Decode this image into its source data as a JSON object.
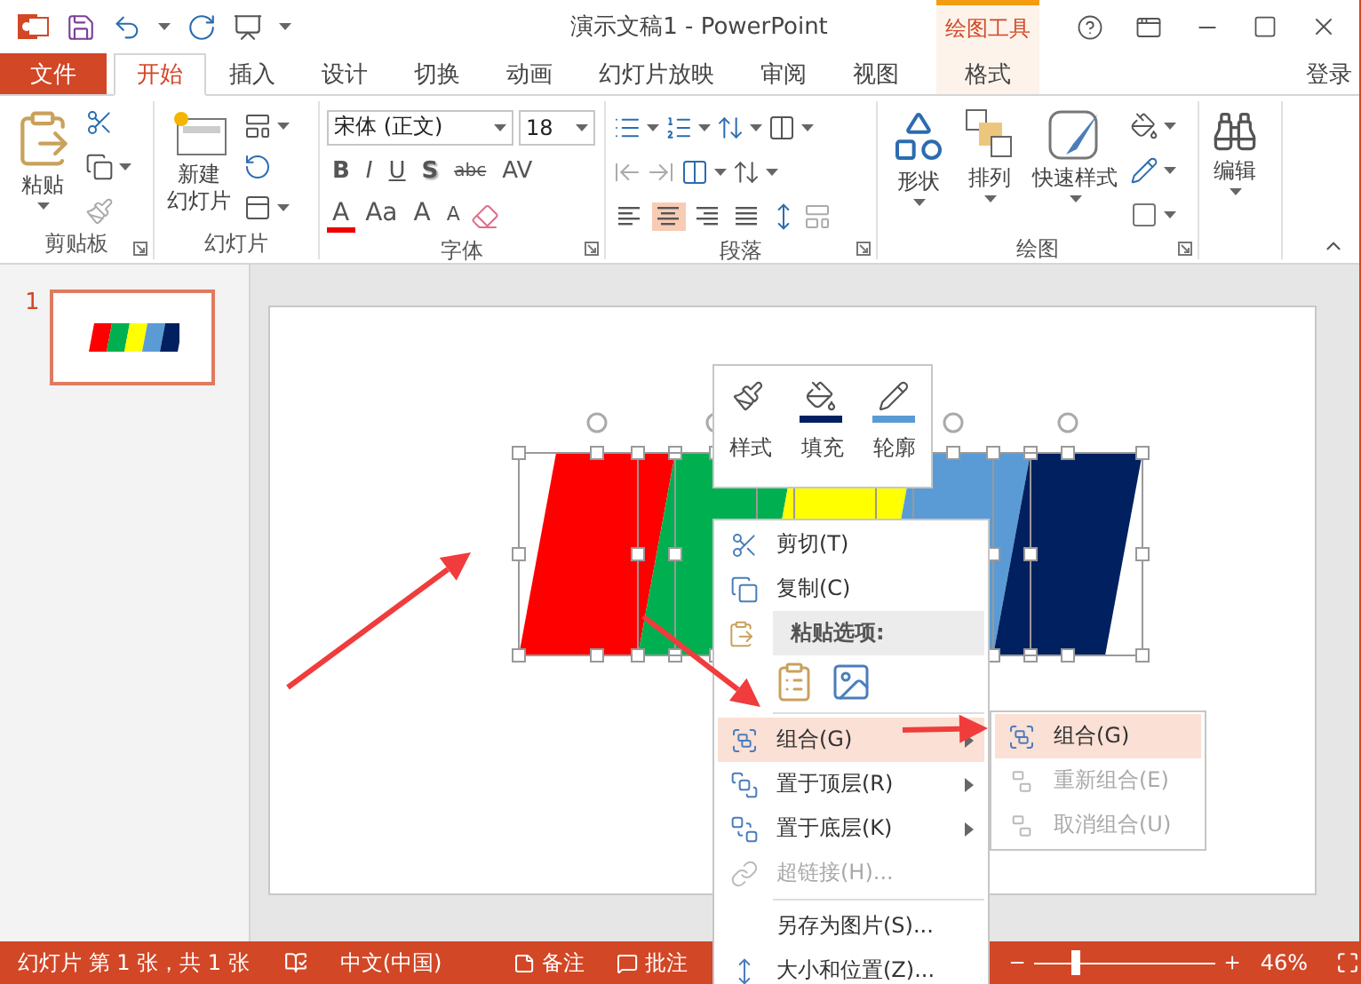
{
  "title_bar": {
    "title": "演示文稿1 - PowerPoint",
    "context_label": "绘图工具"
  },
  "tabs": [
    {
      "label": "文件",
      "kind": "file",
      "selected": false
    },
    {
      "label": "开始",
      "kind": "tab",
      "selected": true
    },
    {
      "label": "插入",
      "kind": "tab",
      "selected": false
    },
    {
      "label": "设计",
      "kind": "tab",
      "selected": false
    },
    {
      "label": "切换",
      "kind": "tab",
      "selected": false
    },
    {
      "label": "动画",
      "kind": "tab",
      "selected": false
    },
    {
      "label": "幻灯片放映",
      "kind": "tab",
      "selected": false
    },
    {
      "label": "审阅",
      "kind": "tab",
      "selected": false
    },
    {
      "label": "视图",
      "kind": "tab",
      "selected": false
    },
    {
      "label": "格式",
      "kind": "context",
      "selected": false
    }
  ],
  "sign_in": "登录",
  "ribbon": {
    "clipboard": {
      "label": "剪贴板",
      "paste": "粘贴"
    },
    "slides": {
      "label": "幻灯片",
      "new_slide": "新建",
      "new_slide_2": "幻灯片"
    },
    "font": {
      "label": "字体",
      "font_name": "宋体 (正文)",
      "font_size": "18",
      "style_buttons": [
        "B",
        "I",
        "U",
        "S",
        "abc",
        "AV"
      ],
      "size_buttons": [
        "A",
        "Aa",
        "A",
        "A"
      ]
    },
    "paragraph": {
      "label": "段落",
      "alignments": [
        {
          "kind": "left",
          "selected": false
        },
        {
          "kind": "center",
          "selected": true
        },
        {
          "kind": "right",
          "selected": false
        },
        {
          "kind": "justify",
          "selected": false
        }
      ]
    },
    "drawing": {
      "label": "绘图",
      "shapes": "形状",
      "arrange": "排列",
      "quick_styles": "快速样式"
    },
    "editing": {
      "label": "编辑"
    }
  },
  "thumbnails": [
    {
      "number": "1",
      "selected": true
    }
  ],
  "slide": {
    "bands": [
      {
        "color": "#ff0000"
      },
      {
        "color": "#00b050"
      },
      {
        "color": "#ffff00"
      },
      {
        "color": "#5b9bd5"
      },
      {
        "color": "#002060"
      }
    ]
  },
  "mini_toolbar": [
    {
      "label": "样式",
      "kind": "style"
    },
    {
      "label": "填充",
      "kind": "fill"
    },
    {
      "label": "轮廓",
      "kind": "outline"
    }
  ],
  "context_menu": [
    {
      "kind": "item",
      "label": "剪切(T)",
      "disabled": false,
      "selected": false,
      "submenu": false
    },
    {
      "kind": "item",
      "label": "复制(C)",
      "disabled": false,
      "selected": false,
      "submenu": false
    },
    {
      "kind": "header",
      "label": "粘贴选项:"
    },
    {
      "kind": "paste_options"
    },
    {
      "kind": "separator"
    },
    {
      "kind": "item",
      "label": "组合(G)",
      "disabled": false,
      "selected": true,
      "submenu": true
    },
    {
      "kind": "item",
      "label": "置于顶层(R)",
      "disabled": false,
      "selected": false,
      "submenu": true
    },
    {
      "kind": "item",
      "label": "置于底层(K)",
      "disabled": false,
      "selected": false,
      "submenu": true
    },
    {
      "kind": "item",
      "label": "超链接(H)...",
      "disabled": true,
      "selected": false,
      "submenu": false
    },
    {
      "kind": "separator"
    },
    {
      "kind": "item",
      "label": "另存为图片(S)...",
      "disabled": false,
      "selected": false,
      "submenu": false
    },
    {
      "kind": "item",
      "label": "大小和位置(Z)...",
      "disabled": false,
      "selected": false,
      "submenu": false
    }
  ],
  "submenu": [
    {
      "label": "组合(G)",
      "selected": true,
      "disabled": false
    },
    {
      "label": "重新组合(E)",
      "selected": false,
      "disabled": true
    },
    {
      "label": "取消组合(U)",
      "selected": false,
      "disabled": true
    }
  ],
  "status_bar": {
    "slide_info": "幻灯片 第 1 张，共 1 张",
    "language": "中文(中国)",
    "notes": "备注",
    "comments": "批注",
    "zoom_slider": {
      "level": 0.22
    },
    "zoom": "46%"
  }
}
